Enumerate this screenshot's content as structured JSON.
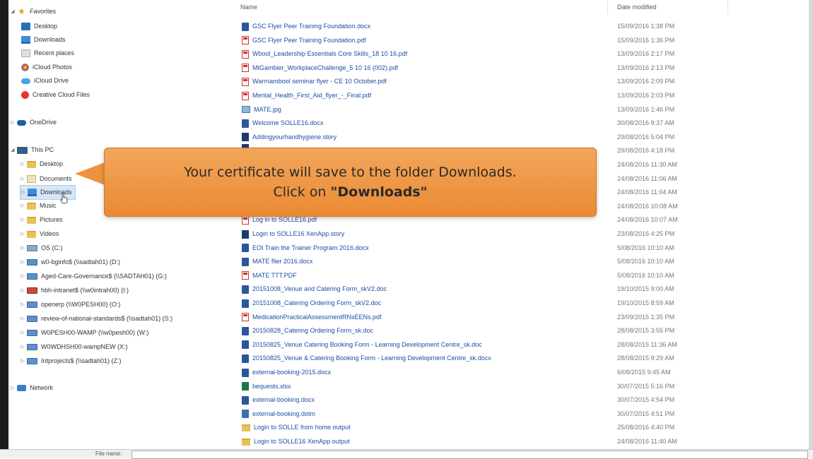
{
  "nav": {
    "favorites_label": "Favorites",
    "favorites": [
      "Desktop",
      "Downloads",
      "Recent places",
      "iCloud Photos",
      "iCloud Drive",
      "Creative Cloud Files"
    ],
    "onedrive_label": "OneDrive",
    "thispc_label": "This PC",
    "thispc_items": [
      "Desktop",
      "Documents",
      "Downloads",
      "Music",
      "Pictures",
      "Videos",
      "OS (C:)",
      "w0-bginfo$ (\\\\sadtah01) (D:)",
      "Aged-Care-Governance$ (\\\\SADTAH01) (G:)",
      "hbh-intranet$ (\\\\w0intrah00) (I:)",
      "openerp (\\\\W0PESH00) (O:)",
      "review-of-national-standards$ (\\\\sadtah01) (S:)",
      "W0PESH00-WAMP (\\\\w0pesh00) (W:)",
      "W0WDHSH00-wampNEW (X:)",
      "Intprojects$ (\\\\sadtah01) (Z:)"
    ],
    "network_label": "Network"
  },
  "list": {
    "col_name": "Name",
    "col_date": "Date modified",
    "files": [
      {
        "name": "GSC Flyer Peer Training Foundation.docx",
        "date": "15/09/2016 1:38 PM",
        "type": "doc"
      },
      {
        "name": "GSC Flyer Peer Training Foundation.pdf",
        "date": "15/09/2016 1:36 PM",
        "type": "pdf"
      },
      {
        "name": "Wbool_Leadership Essentials Core Skills_18 10 16.pdf",
        "date": "13/09/2016 2:17 PM",
        "type": "pdf"
      },
      {
        "name": "MtGambier_WorkplaceChallenge_5 10 16 (002).pdf",
        "date": "13/09/2016 2:13 PM",
        "type": "pdf"
      },
      {
        "name": "Warrnambool seminar flyer - CE 10 October.pdf",
        "date": "13/09/2016 2:09 PM",
        "type": "pdf"
      },
      {
        "name": "Mental_Health_First_Aid_flyer_-_Final.pdf",
        "date": "13/09/2016 2:03 PM",
        "type": "pdf"
      },
      {
        "name": "MATE.jpg",
        "date": "13/09/2016 1:46 PM",
        "type": "jpg"
      },
      {
        "name": "Welcome SOLLE16.docx",
        "date": "30/08/2016 9:37 AM",
        "type": "doc"
      },
      {
        "name": "Addingyourhandhygiene.story",
        "date": "29/08/2016 5:04 PM",
        "type": "story"
      },
      {
        "name": "",
        "date": "29/08/2016 4:18 PM",
        "type": "story"
      },
      {
        "name": "",
        "date": "24/08/2016 11:30 AM",
        "type": "doc"
      },
      {
        "name": "",
        "date": "24/08/2016 11:06 AM",
        "type": "doc"
      },
      {
        "name": "",
        "date": "24/08/2016 11:04 AM",
        "type": "doc"
      },
      {
        "name": "",
        "date": "24/08/2016 10:08 AM",
        "type": "doc"
      },
      {
        "name": "Log in to SOLLE16.pdf",
        "date": "24/08/2016 10:07 AM",
        "type": "pdf"
      },
      {
        "name": "Login to SOLLE16 XenApp.story",
        "date": "23/08/2016 4:25 PM",
        "type": "story"
      },
      {
        "name": "EOI Train the Trainer Program 2016.docx",
        "date": "5/08/2016 10:10 AM",
        "type": "doc"
      },
      {
        "name": "MATE flier 2016.docx",
        "date": "5/08/2016 10:10 AM",
        "type": "doc"
      },
      {
        "name": "MATE TTT.PDF",
        "date": "5/08/2016 10:10 AM",
        "type": "pdf"
      },
      {
        "name": "20151008_Venue and Catering Form_skV2.doc",
        "date": "19/10/2015 9:00 AM",
        "type": "doc"
      },
      {
        "name": "20151008_Catering Ordering Form_skV2.doc",
        "date": "19/10/2015 8:59 AM",
        "type": "doc"
      },
      {
        "name": "MedicationPracticalAssessmentRNsEENs.pdf",
        "date": "23/09/2015 1:35 PM",
        "type": "pdf"
      },
      {
        "name": "20150828_Catering Ordering Form_sk.doc",
        "date": "28/08/2015 3:55 PM",
        "type": "doc"
      },
      {
        "name": "20150825_Venue  Catering Booking Form - Learning  Development Centre_sk.doc",
        "date": "28/08/2015 11:36 AM",
        "type": "doc"
      },
      {
        "name": "20150825_Venue & Catering Booking Form - Learning  Development Centre_sk.docx",
        "date": "28/08/2015 9:29 AM",
        "type": "doc"
      },
      {
        "name": "external-booking-2015.docx",
        "date": "6/08/2015 9:45 AM",
        "type": "doc"
      },
      {
        "name": "bequests.xlsx",
        "date": "30/07/2015 5:16 PM",
        "type": "xls"
      },
      {
        "name": "external-booking.docx",
        "date": "30/07/2015 4:54 PM",
        "type": "doc"
      },
      {
        "name": "external-booking.dotm",
        "date": "30/07/2015 4:51 PM",
        "type": "dotm"
      },
      {
        "name": "Login to SOLLE from home output",
        "date": "25/08/2016 4:40 PM",
        "type": "folder"
      },
      {
        "name": "Login to SOLLE16 XenApp output",
        "date": "24/08/2016 11:40 AM",
        "type": "folder"
      }
    ]
  },
  "callout": {
    "line1": "Your certificate will save to the folder Downloads.",
    "line2_prefix": "Click on ",
    "line2_bold": "\"Downloads\""
  },
  "bottom": {
    "label": "File name:"
  }
}
